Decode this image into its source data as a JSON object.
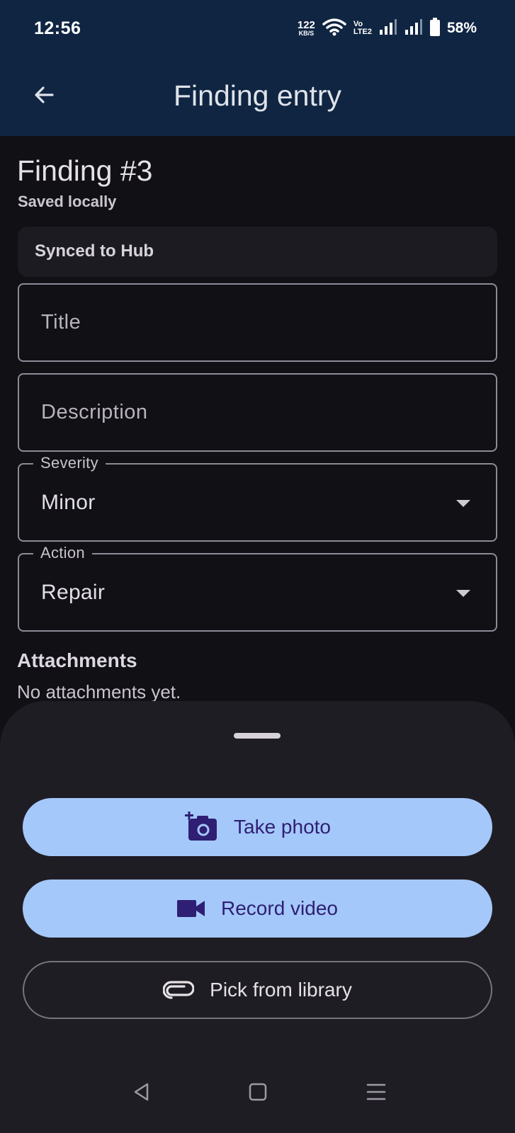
{
  "status_bar": {
    "time": "12:56",
    "net_speed_value": "122",
    "net_speed_unit": "KB/S",
    "volte_top": "Vo",
    "volte_bottom": "LTE2",
    "battery": "58%"
  },
  "app_bar": {
    "title": "Finding entry",
    "back_icon": "arrow-back-icon"
  },
  "finding": {
    "title": "Finding #3",
    "save_state": "Saved locally",
    "sync_status": "Synced to Hub"
  },
  "form": {
    "title_placeholder": "Title",
    "description_placeholder": "Description",
    "severity_label": "Severity",
    "severity_value": "Minor",
    "action_label": "Action",
    "action_value": "Repair"
  },
  "attachments": {
    "heading": "Attachments",
    "empty_text": "No attachments yet."
  },
  "sheet": {
    "take_photo": "Take photo",
    "take_photo_icon": "add-a-photo-icon",
    "record_video": "Record video",
    "record_video_icon": "videocam-icon",
    "pick_library": "Pick from library",
    "pick_library_icon": "attachment-icon"
  },
  "colors": {
    "app_bar_bg": "#0f2542",
    "background": "#111015",
    "sheet_bg": "#1f1d24",
    "primary_button": "#a5c8fa",
    "primary_button_text": "#2e1f74"
  }
}
